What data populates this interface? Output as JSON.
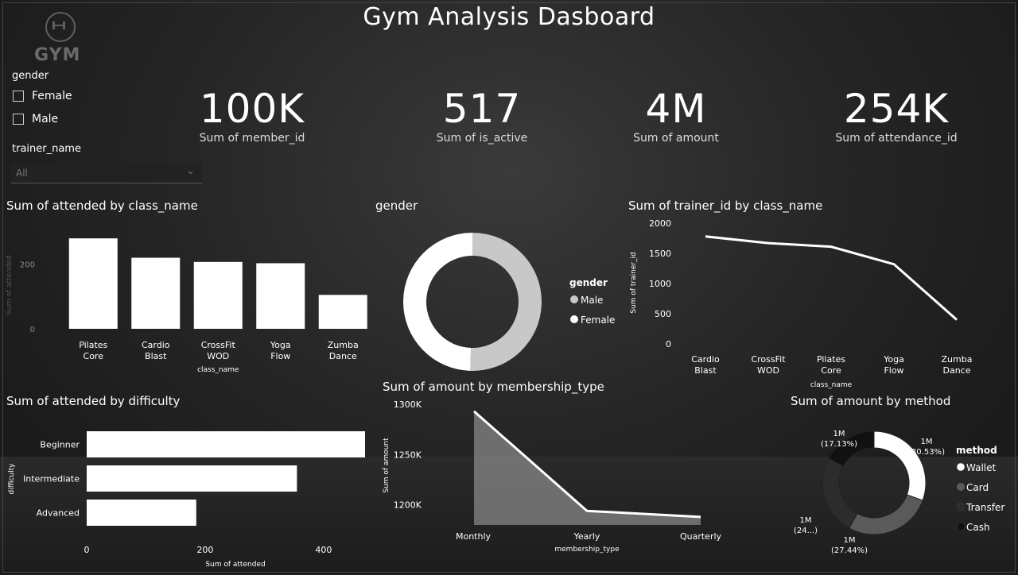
{
  "title": "Gym Analysis Dasboard",
  "logo": {
    "text": "GYM",
    "icon": "dumbbell-icon"
  },
  "slicers": {
    "gender": {
      "title": "gender",
      "options": [
        "Female",
        "Male"
      ]
    },
    "trainer": {
      "title": "trainer_name",
      "value": "All"
    }
  },
  "kpis": [
    {
      "value": "100K",
      "label": "Sum of member_id"
    },
    {
      "value": "517",
      "label": "Sum of is_active"
    },
    {
      "value": "4M",
      "label": "Sum of amount"
    },
    {
      "value": "254K",
      "label": "Sum of attendance_id"
    }
  ],
  "visual_titles": {
    "attended_by_class": "Sum of attended by class_name",
    "gender_donut": "gender",
    "trainer_by_class": "Sum of trainer_id by class_name",
    "attended_by_difficulty": "Sum of attended by difficulty",
    "amount_by_membership": "Sum of amount by membership_type",
    "amount_by_method": "Sum of amount by method"
  },
  "colors": {
    "bar": "#ffffff",
    "male": "#c8c8c8",
    "female": "#ffffff",
    "wallet": "#ffffff",
    "card": "#5a5a5a",
    "transfer": "#2c2c2c",
    "cash": "#111111"
  },
  "chart_data": [
    {
      "id": "attended_by_class",
      "type": "bar",
      "categories": [
        "Pilates Core",
        "Cardio Blast",
        "CrossFit WOD",
        "Yoga Flow",
        "Zumba Dance"
      ],
      "values": [
        280,
        220,
        207,
        203,
        105
      ],
      "xlabel": "class_name",
      "ylabel": "Sum of attended",
      "yticks": [
        0,
        200
      ],
      "ylim": [
        0,
        300
      ]
    },
    {
      "id": "gender_donut",
      "type": "pie",
      "donut": true,
      "legend_title": "gender",
      "categories": [
        "Male",
        "Female"
      ],
      "values": [
        50.5,
        49.5
      ],
      "legend_position": "right"
    },
    {
      "id": "trainer_by_class",
      "type": "line",
      "categories": [
        "Cardio Blast",
        "CrossFit WOD",
        "Pilates Core",
        "Yoga Flow",
        "Zumba Dance"
      ],
      "values": [
        1780,
        1670,
        1610,
        1320,
        400
      ],
      "xlabel": "class_name",
      "ylabel": "Sum of trainer_id",
      "yticks": [
        0,
        500,
        1000,
        1500,
        2000
      ],
      "ylim": [
        0,
        2000
      ]
    },
    {
      "id": "attended_by_difficulty",
      "type": "bar",
      "orientation": "horizontal",
      "categories": [
        "Beginner",
        "Intermediate",
        "Advanced"
      ],
      "values": [
        470,
        355,
        185
      ],
      "xlabel": "Sum of attended",
      "ylabel": "difficulty",
      "xticks": [
        0,
        200,
        400
      ],
      "xlim": [
        0,
        470
      ]
    },
    {
      "id": "amount_by_membership",
      "type": "area",
      "categories": [
        "Monthly",
        "Yearly",
        "Quarterly"
      ],
      "values": [
        1293000,
        1194000,
        1188000
      ],
      "xlabel": "membership_type",
      "ylabel": "Sum of amount",
      "yticks": [
        1200000,
        1250000,
        1300000
      ],
      "ytick_labels": [
        "1200K",
        "1250K",
        "1300K"
      ],
      "ylim": [
        1180000,
        1300000
      ]
    },
    {
      "id": "amount_by_method",
      "type": "pie",
      "donut": true,
      "legend_title": "method",
      "categories": [
        "Wallet",
        "Card",
        "Transfer",
        "Cash"
      ],
      "values": [
        30.53,
        27.44,
        24.9,
        17.13
      ],
      "data_labels": [
        "1M\n(30.53%)",
        "1M\n(27.44%)",
        "1M\n(24...)",
        "1M\n(17.13%)"
      ],
      "legend_position": "right"
    }
  ]
}
